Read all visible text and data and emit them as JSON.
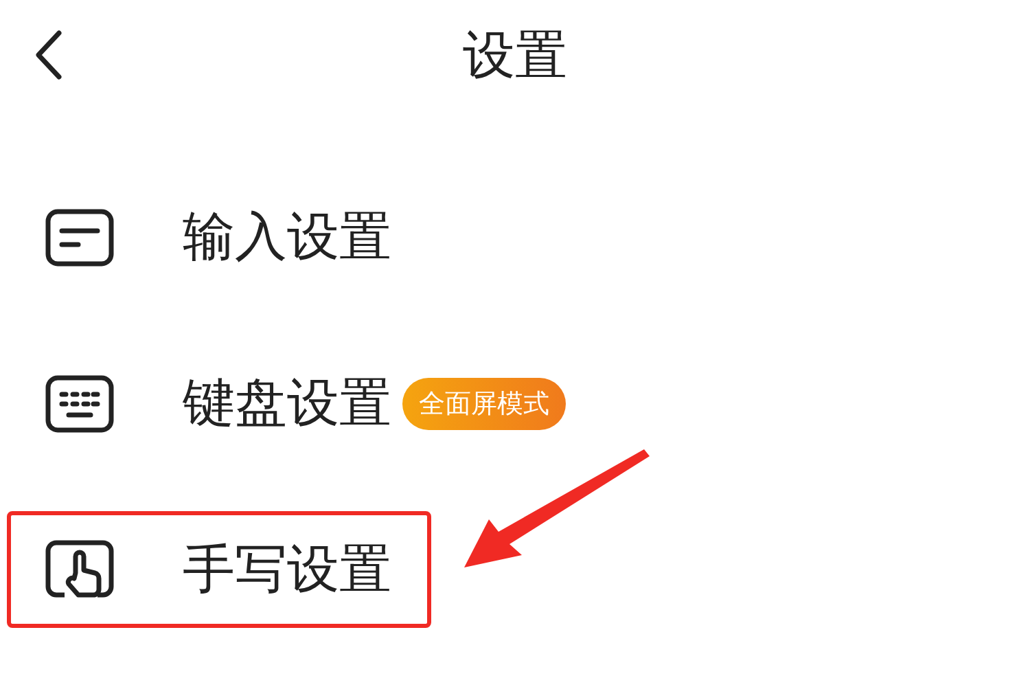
{
  "header": {
    "title": "设置"
  },
  "items": [
    {
      "kind": "input",
      "label": "输入设置",
      "highlighted": false
    },
    {
      "kind": "keyboard",
      "label": "键盘设置",
      "badge": "全面屏模式",
      "highlighted": false
    },
    {
      "kind": "handwriting",
      "label": "手写设置",
      "highlighted": true
    }
  ],
  "annotation": {
    "kind": "arrow"
  }
}
